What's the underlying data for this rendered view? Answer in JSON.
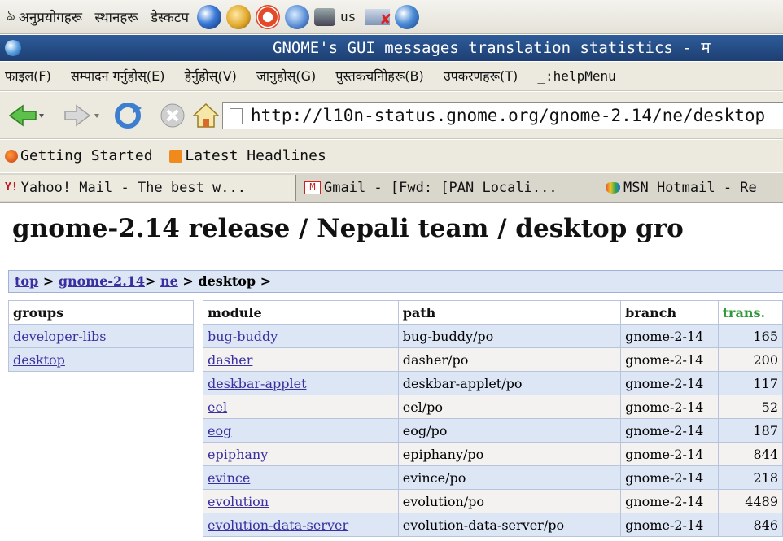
{
  "panel": {
    "menus": [
      "अनुप्रयोगहरू",
      "स्थानहरू",
      "डेस्कटप"
    ],
    "workspace_label": "us"
  },
  "window": {
    "title": "GNOME's GUI messages translation statistics - म"
  },
  "menubar": {
    "items": [
      "फाइल(F)",
      "सम्पादन गर्नुहोस्(E)",
      "हेर्नुहोस्(V)",
      "जानुहोस्(G)",
      "पुस्तकचनिोहरू(B)",
      "उपकरणहरू(T)",
      "_:helpMenu"
    ]
  },
  "toolbar": {
    "url": "http://l10n-status.gnome.org/gnome-2.14/ne/desktop"
  },
  "bookmarks": {
    "items": [
      "Getting Started",
      "Latest Headlines"
    ]
  },
  "tabs": {
    "items": [
      "Yahoo! Mail - The best w...",
      "Gmail - [Fwd: [PAN Locali...",
      "MSN Hotmail - Re"
    ]
  },
  "page": {
    "heading": "gnome-2.14 release / Nepali team / desktop gro",
    "breadcrumb": {
      "sep": ">",
      "top": "top",
      "release": "gnome-2.14",
      "lang": "ne",
      "current": "desktop"
    },
    "groups": {
      "header": "groups",
      "items": [
        "developer-libs",
        "desktop"
      ]
    },
    "modules": {
      "headers": {
        "module": "module",
        "path": "path",
        "branch": "branch",
        "trans": "trans."
      },
      "rows": [
        {
          "module": "bug-buddy",
          "path": "bug-buddy/po",
          "branch": "gnome-2-14",
          "trans": "165"
        },
        {
          "module": "dasher",
          "path": "dasher/po",
          "branch": "gnome-2-14",
          "trans": "200"
        },
        {
          "module": "deskbar-applet",
          "path": "deskbar-applet/po",
          "branch": "gnome-2-14",
          "trans": "117"
        },
        {
          "module": "eel",
          "path": "eel/po",
          "branch": "gnome-2-14",
          "trans": "52"
        },
        {
          "module": "eog",
          "path": "eog/po",
          "branch": "gnome-2-14",
          "trans": "187"
        },
        {
          "module": "epiphany",
          "path": "epiphany/po",
          "branch": "gnome-2-14",
          "trans": "844"
        },
        {
          "module": "evince",
          "path": "evince/po",
          "branch": "gnome-2-14",
          "trans": "218"
        },
        {
          "module": "evolution",
          "path": "evolution/po",
          "branch": "gnome-2-14",
          "trans": "4489"
        },
        {
          "module": "evolution-data-server",
          "path": "evolution-data-server/po",
          "branch": "gnome-2-14",
          "trans": "846"
        }
      ]
    }
  }
}
